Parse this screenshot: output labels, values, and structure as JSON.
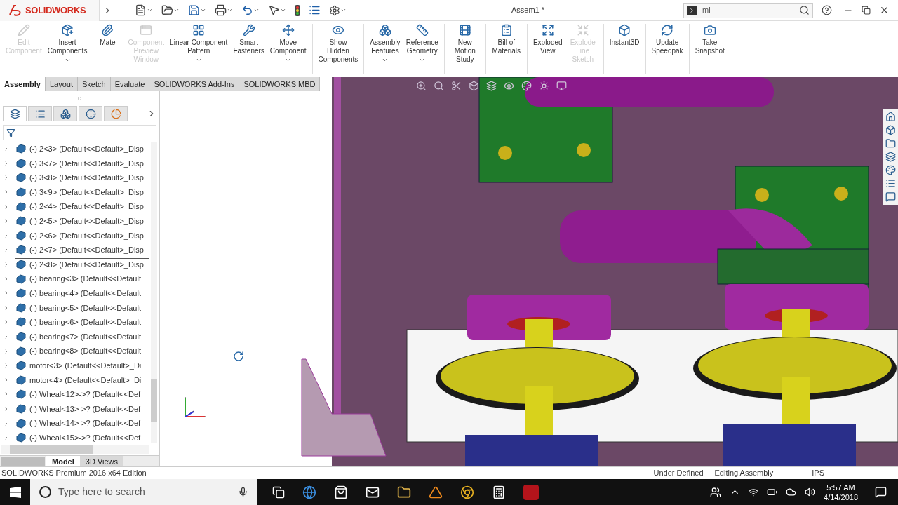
{
  "app": {
    "logo": "SOLIDWORKS",
    "title": "Assem1 *",
    "search": {
      "value": "mi"
    }
  },
  "ribbon": [
    {
      "label": "Edit\nComponent",
      "disabled": true,
      "dropdown": false
    },
    {
      "label": "Insert\nComponents",
      "disabled": false,
      "dropdown": true
    },
    {
      "label": "Mate",
      "disabled": false,
      "dropdown": false
    },
    {
      "label": "Component\nPreview\nWindow",
      "disabled": true,
      "dropdown": false
    },
    {
      "label": "Linear Component\nPattern",
      "disabled": false,
      "dropdown": true
    },
    {
      "label": "Smart\nFasteners",
      "disabled": false,
      "dropdown": false
    },
    {
      "label": "Move\nComponent",
      "disabled": false,
      "dropdown": true
    },
    {
      "label": "Show\nHidden\nComponents",
      "disabled": false,
      "dropdown": false
    },
    {
      "label": "Assembly\nFeatures",
      "disabled": false,
      "dropdown": true
    },
    {
      "label": "Reference\nGeometry",
      "disabled": false,
      "dropdown": true
    },
    {
      "label": "New\nMotion\nStudy",
      "disabled": false,
      "dropdown": false
    },
    {
      "label": "Bill of\nMaterials",
      "disabled": false,
      "dropdown": false
    },
    {
      "label": "Exploded\nView",
      "disabled": false,
      "dropdown": false
    },
    {
      "label": "Explode\nLine\nSketch",
      "disabled": true,
      "dropdown": false
    },
    {
      "label": "Instant3D",
      "disabled": false,
      "dropdown": false
    },
    {
      "label": "Update\nSpeedpak",
      "disabled": false,
      "dropdown": false
    },
    {
      "label": "Take\nSnapshot",
      "disabled": false,
      "dropdown": false
    }
  ],
  "tabs": [
    {
      "label": "Assembly",
      "selected": true
    },
    {
      "label": "Layout",
      "selected": false
    },
    {
      "label": "Sketch",
      "selected": false
    },
    {
      "label": "Evaluate",
      "selected": false
    },
    {
      "label": "SOLIDWORKS Add-Ins",
      "selected": false
    },
    {
      "label": "SOLIDWORKS MBD",
      "selected": false
    }
  ],
  "tree": [
    {
      "label": "(-) 2<3> (Default<<Default>_Disp",
      "selected": false
    },
    {
      "label": "(-) 3<7> (Default<<Default>_Disp",
      "selected": false
    },
    {
      "label": "(-) 3<8> (Default<<Default>_Disp",
      "selected": false
    },
    {
      "label": "(-) 3<9> (Default<<Default>_Disp",
      "selected": false
    },
    {
      "label": "(-) 2<4> (Default<<Default>_Disp",
      "selected": false
    },
    {
      "label": "(-) 2<5> (Default<<Default>_Disp",
      "selected": false
    },
    {
      "label": "(-) 2<6> (Default<<Default>_Disp",
      "selected": false
    },
    {
      "label": "(-) 2<7> (Default<<Default>_Disp",
      "selected": false
    },
    {
      "label": "(-) 2<8> (Default<<Default>_Disp",
      "selected": true
    },
    {
      "label": "(-) bearing<3> (Default<<Default",
      "selected": false
    },
    {
      "label": "(-) bearing<4> (Default<<Default",
      "selected": false
    },
    {
      "label": "(-) bearing<5> (Default<<Default",
      "selected": false
    },
    {
      "label": "(-) bearing<6> (Default<<Default",
      "selected": false
    },
    {
      "label": "(-) bearing<7> (Default<<Default",
      "selected": false
    },
    {
      "label": "(-) bearing<8> (Default<<Default",
      "selected": false
    },
    {
      "label": "motor<3> (Default<<Default>_Di",
      "selected": false
    },
    {
      "label": "motor<4> (Default<<Default>_Di",
      "selected": false
    },
    {
      "label": "(-) Wheal<12>->? (Default<<Def",
      "selected": false
    },
    {
      "label": "(-) Wheal<13>->? (Default<<Def",
      "selected": false
    },
    {
      "label": "(-) Wheal<14>->? (Default<<Def",
      "selected": false
    },
    {
      "label": "(-) Wheal<15>->? (Default<<Def",
      "selected": false
    }
  ],
  "bottom_tabs": [
    {
      "label": "Model",
      "selected": true
    },
    {
      "label": "3D Views",
      "selected": false
    }
  ],
  "status_bar": {
    "edition": "SOLIDWORKS Premium 2016 x64 Edition",
    "state": "Under Defined",
    "mode": "Editing Assembly",
    "units": "IPS"
  },
  "taskbar": {
    "search_placeholder": "Type here to search",
    "time": "5:57 AM",
    "date": "4/14/2018"
  }
}
